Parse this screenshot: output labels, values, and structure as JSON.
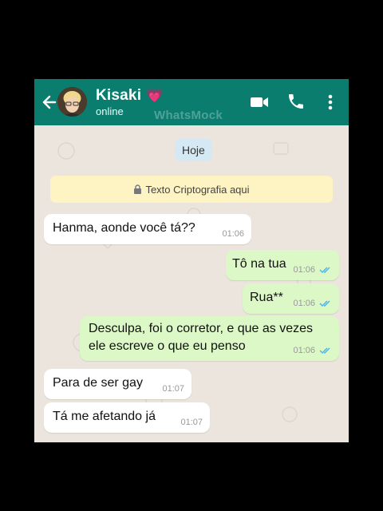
{
  "header": {
    "contact_name": "Kisaki",
    "heart": "💗",
    "status": "online",
    "watermark": "WhatsMock",
    "icons": [
      "back-arrow-icon",
      "video-call-icon",
      "phone-icon",
      "more-vert-icon"
    ],
    "color": "#0a7d6f"
  },
  "chat": {
    "date_label": "Hoje",
    "encryption_notice": "Texto Criptografia aqui",
    "messages": [
      {
        "direction": "in",
        "text": "Hanma, aonde você tá??",
        "time": "01:06"
      },
      {
        "direction": "out",
        "text": "Tô na tua",
        "time": "01:06",
        "read": true
      },
      {
        "direction": "out",
        "text": "Rua**",
        "time": "01:06",
        "read": true
      },
      {
        "direction": "out",
        "line1": "Desculpa, foi o corretor, e que as vezes",
        "line2": "ele escreve o que eu penso",
        "time": "01:06",
        "read": true
      },
      {
        "direction": "in",
        "text": "Para de ser gay",
        "time": "01:07"
      },
      {
        "direction": "in",
        "text": "Tá me afetando já",
        "time": "01:07"
      }
    ]
  },
  "colors": {
    "outgoing_bubble": "#dcf8c6",
    "incoming_bubble": "#ffffff",
    "read_check": "#4fb6ec",
    "chat_background": "#ece5dd"
  }
}
